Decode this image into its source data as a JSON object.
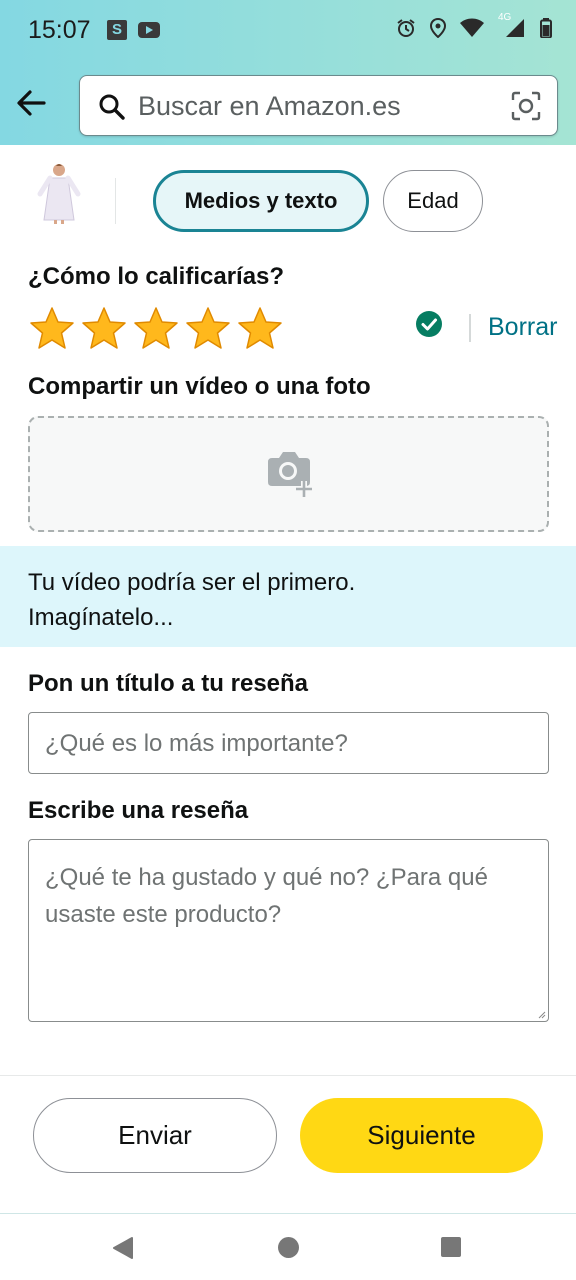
{
  "status_bar": {
    "time": "15:07",
    "notification_s": "S",
    "network": "4G"
  },
  "search": {
    "placeholder": "Buscar en Amazon.es"
  },
  "tabs": [
    {
      "label": "Medios y texto",
      "selected": true
    },
    {
      "label": "Edad",
      "selected": false
    }
  ],
  "rating": {
    "heading": "¿Cómo lo calificarías?",
    "stars": 5,
    "max_stars": 5,
    "clear_label": "Borrar",
    "star_color": "#ffa41c"
  },
  "media": {
    "heading": "Compartir un vídeo o una foto"
  },
  "info_banner": {
    "line1": "Tu vídeo podría ser el primero.",
    "line2": "Imagínatelo..."
  },
  "title_field": {
    "heading": "Pon un título a tu reseña",
    "placeholder": "¿Qué es lo más importante?"
  },
  "review_field": {
    "heading": "Escribe una reseña",
    "placeholder": "¿Qué te ha gustado y qué no? ¿Para qué usaste este producto?"
  },
  "actions": {
    "send_label": "Enviar",
    "next_label": "Siguiente"
  },
  "colors": {
    "accent": "#007185",
    "primary_button": "#ffd814",
    "banner": "#ddf6fb"
  }
}
